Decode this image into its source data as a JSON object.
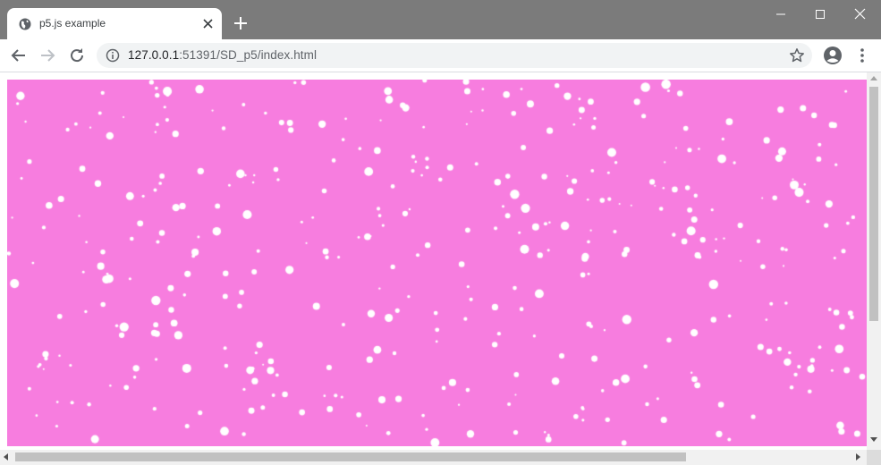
{
  "browser": {
    "tab_title": "p5.js example",
    "url_host": "127.0.0.1",
    "url_rest": ":51391/SD_p5/index.html",
    "icons": {
      "favicon": "globe-icon",
      "tab_close": "close-icon",
      "new_tab": "plus-icon",
      "minimize": "minimize-icon",
      "maximize": "maximize-icon",
      "close": "close-icon",
      "back": "arrow-left-icon",
      "forward": "arrow-right-icon",
      "reload": "reload-icon",
      "site_info": "info-icon",
      "bookmark": "star-icon",
      "profile": "account-icon",
      "menu": "kebab-menu-icon"
    }
  },
  "canvas": {
    "background_color": "#f77ddf",
    "particle_color": "#ffffff",
    "description": "snowfall particles"
  },
  "colors": {
    "titlebar": "#7b7b7b",
    "tab_bg": "#ffffff",
    "omnibox_bg": "#f1f3f4"
  }
}
